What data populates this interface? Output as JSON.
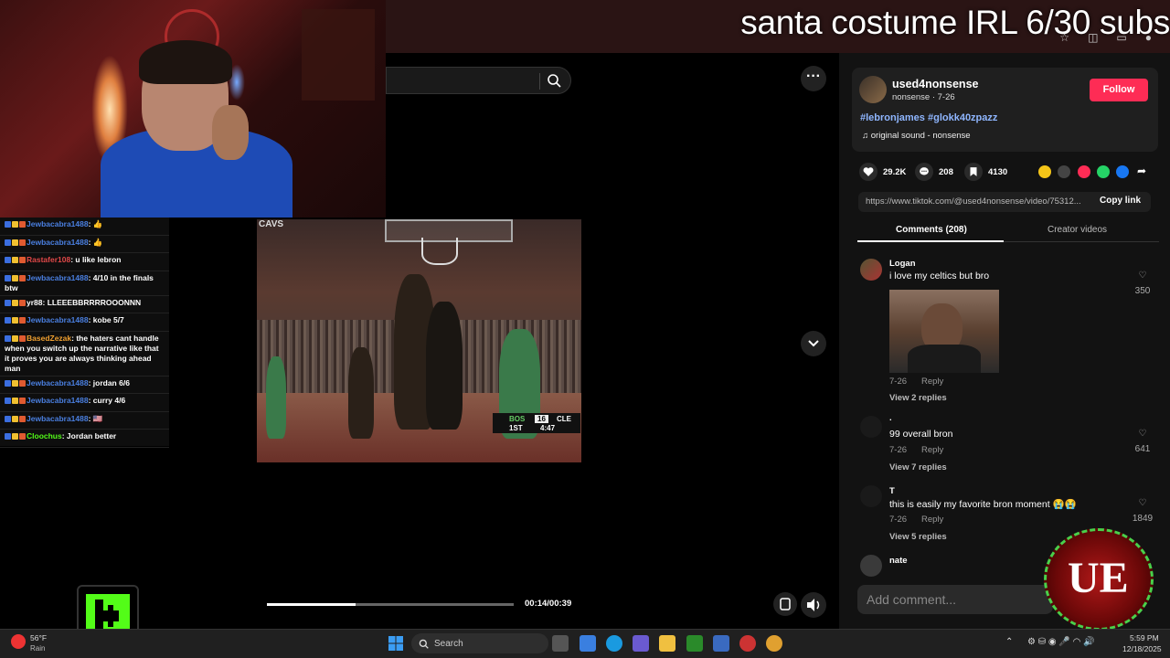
{
  "overlay": {
    "title": "santa costume IRL 6/30 subs"
  },
  "chat": {
    "messages": [
      {
        "user": "Jewbacabra1488",
        "text": ": 👍",
        "color": "#4a7fe0"
      },
      {
        "user": "Jewbacabra1488",
        "text": ": 👍",
        "color": "#4a7fe0"
      },
      {
        "user": "Rastafer108",
        "text": ": u like lebron",
        "color": "#e04848"
      },
      {
        "user": "Jewbacabra1488",
        "text": ": 4/10 in the finals btw",
        "color": "#4a7fe0"
      },
      {
        "user": "yr88",
        "text": ": LLEEEBBRRRROOONNN",
        "color": "#ffffff"
      },
      {
        "user": "Jewbacabra1488",
        "text": ": kobe 5/7",
        "color": "#4a7fe0"
      },
      {
        "user": "BasedZezak",
        "text": ": the haters cant handle when you switch up the narrative like that it proves you are always thinking ahead man",
        "color": "#f0a030"
      },
      {
        "user": "Jewbacabra1488",
        "text": ": jordan 6/6",
        "color": "#4a7fe0"
      },
      {
        "user": "Jewbacabra1488",
        "text": ": curry 4/6",
        "color": "#4a7fe0"
      },
      {
        "user": "Jewbacabra1488",
        "text": ": 🇺🇸",
        "color": "#4a7fe0"
      },
      {
        "user": "Cloochus",
        "text": ": Jordan better",
        "color": "#53fc18"
      }
    ]
  },
  "video": {
    "scorebug": {
      "team1": "BOS",
      "score1": "16",
      "team2": "CLE",
      "quarter": "1ST",
      "clock": "4:47"
    },
    "time": "00:14/00:39",
    "progress": 0.36
  },
  "creator": {
    "name": "used4nonsense",
    "subtitle": "nonsense · 7-26",
    "follow_label": "Follow",
    "hashtags": "#lebronjames #glokk40zpazz",
    "sound": "original sound - nonsense"
  },
  "stats": {
    "likes": "29.2K",
    "comments": "208",
    "saves": "4130"
  },
  "link": {
    "url": "https://www.tiktok.com/@used4nonsense/video/75312...",
    "copy_label": "Copy link"
  },
  "tabs": {
    "comments": "Comments (208)",
    "creator_videos": "Creator videos"
  },
  "comments": [
    {
      "name": "Logan",
      "text": "i love my celtics but bro",
      "date": "7-26",
      "reply": "Reply",
      "replies": "View 2 replies",
      "likes": "350"
    },
    {
      "name": ".",
      "text": "99 overall bron",
      "date": "7-26",
      "reply": "Reply",
      "replies": "View 7 replies",
      "likes": "641"
    },
    {
      "name": "T",
      "text": "this is easily my favorite bron moment 😭😭",
      "date": "7-26",
      "reply": "Reply",
      "replies": "View 5 replies",
      "likes": "1849"
    },
    {
      "name": "nate",
      "text": "",
      "date": "",
      "reply": "",
      "replies": "",
      "likes": ""
    }
  ],
  "add_comment": {
    "placeholder": "Add comment..."
  },
  "taskbar": {
    "weather_temp": "56°F",
    "weather_desc": "Rain",
    "search_label": "Search",
    "time": "5:59 PM",
    "date": "12/18/2025"
  },
  "colors": {
    "accent": "#fe2c55",
    "kick": "#53fc18",
    "hashtag": "#8fb6ff"
  }
}
